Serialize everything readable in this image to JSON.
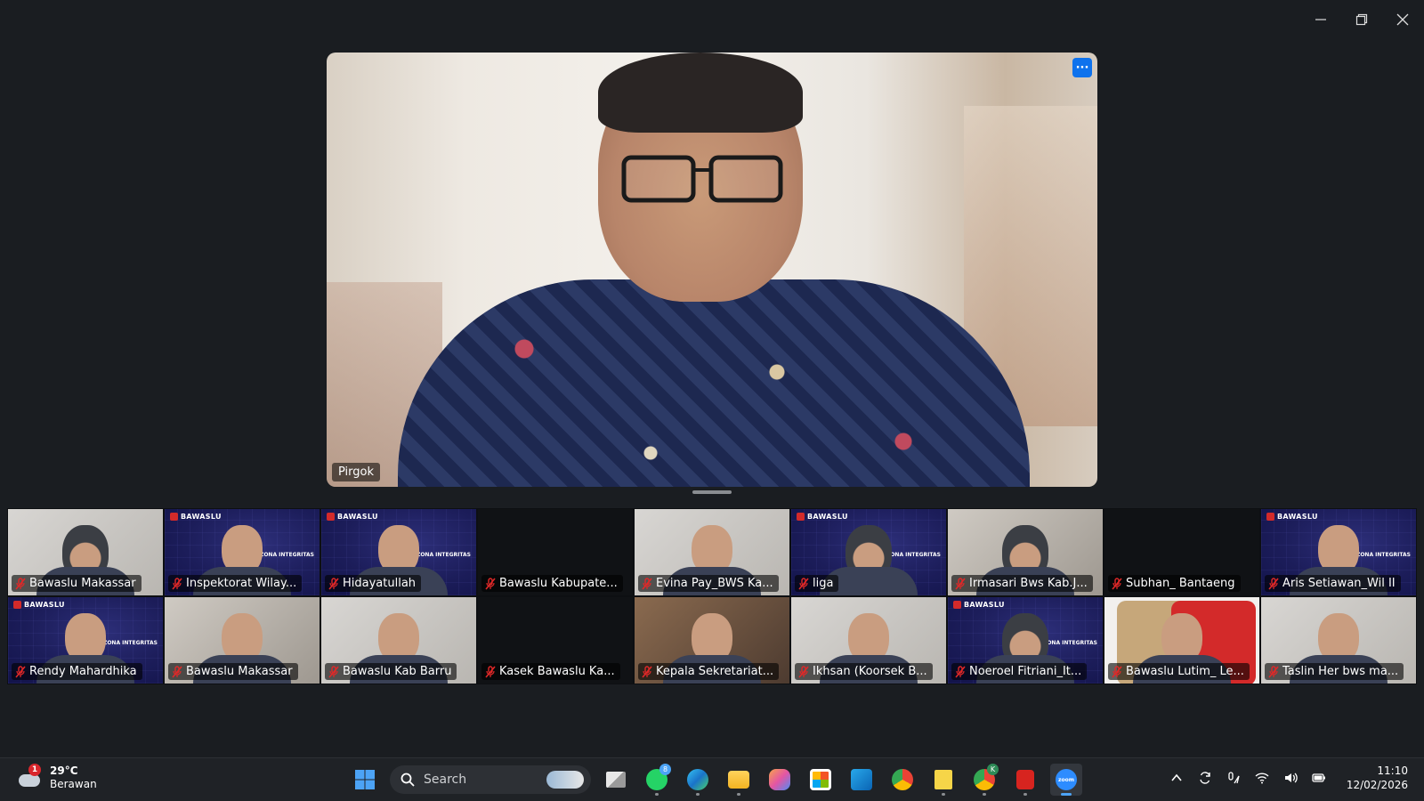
{
  "speaker": {
    "name": "Pirgok",
    "more_label": "···"
  },
  "gallery": {
    "participants": [
      {
        "name": "Bawaslu Makassar",
        "bg": "light"
      },
      {
        "name": "Inspektorat Wilay...",
        "bg": "bawaslu"
      },
      {
        "name": "Hidayatullah",
        "bg": "bawaslu"
      },
      {
        "name": "Bawaslu Kabupate...",
        "bg": "dark"
      },
      {
        "name": "Evina Pay_BWS Ka...",
        "bg": "light"
      },
      {
        "name": "liga",
        "bg": "bawaslu"
      },
      {
        "name": "Irmasari Bws Kab.J...",
        "bg": "room"
      },
      {
        "name": "Subhan_ Bantaeng",
        "bg": "dark"
      },
      {
        "name": "Aris Setiawan_Wil II",
        "bg": "bawaslu"
      },
      {
        "name": "Rendy Mahardhika",
        "bg": "bawaslu"
      },
      {
        "name": "Bawaslu Makassar",
        "bg": "room"
      },
      {
        "name": "Bawaslu Kab Barru",
        "bg": "light"
      },
      {
        "name": "Kasek Bawaslu Ka...",
        "bg": "dark"
      },
      {
        "name": "Kepala Sekretariat...",
        "bg": "warm"
      },
      {
        "name": "Ikhsan (Koorsek B...",
        "bg": "light"
      },
      {
        "name": "Noeroel Fitriani_It...",
        "bg": "bawaslu"
      },
      {
        "name": "Bawaslu Lutim_ Le...",
        "bg": "logo-red"
      },
      {
        "name": "Taslin Her bws ma...",
        "bg": "light"
      }
    ],
    "bawaslu_badge": "BAWASLU",
    "zona_text": "ZONA INTEGRITAS"
  },
  "taskbar": {
    "weather": {
      "temp": "29°C",
      "condition": "Berawan",
      "badge": "1"
    },
    "search_placeholder": "Search",
    "whatsapp_badge": "8",
    "chrome_badge": "K",
    "zoom_label": "zoom",
    "time": "11:10",
    "date": "12/02/2026"
  },
  "colors": {
    "accent": "#0e72ed",
    "mic_off": "#e02828",
    "taskbar": "#1f2226"
  }
}
